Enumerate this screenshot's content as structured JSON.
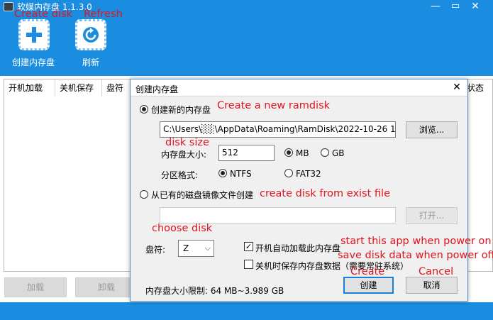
{
  "app": {
    "title": "软媒内存盘 1.1.3.0",
    "window_controls": {
      "minimize": "—",
      "restore": "▭",
      "close": "✕"
    },
    "toolbar": {
      "create_label": "创建内存盘",
      "refresh_label": "刷新"
    },
    "table": {
      "columns": [
        "开机加载",
        "关机保存",
        "盘符",
        "状态"
      ]
    },
    "buttons": {
      "load": "加载",
      "unload": "卸载"
    }
  },
  "dialog": {
    "title": "创建内存盘",
    "close": "✕",
    "option_new": "创建新的内存盘",
    "path_value": "C:\\Users\\░░\\AppData\\Roaming\\RamDisk\\2022-10-26 1",
    "browse_label": "浏览...",
    "size_label": "内存盘大小:",
    "size_value": "512",
    "unit_mb": "MB",
    "unit_gb": "GB",
    "partition_label": "分区格式:",
    "fs_ntfs": "NTFS",
    "fs_fat32": "FAT32",
    "option_image": "从已有的磁盘镜像文件创建",
    "image_path_value": "",
    "open_label": "打开...",
    "drive_label": "盘符:",
    "drive_value": "Z",
    "startup_load_label": "开机自动加载此内存盘",
    "shutdown_save_label": "关机时保存内存盘数据（需要常驻系统）",
    "limit_text": "内存盘大小限制: 64 MB~3.989 GB",
    "create_label": "创建",
    "cancel_label": "取消",
    "state": {
      "option_new_selected": true,
      "unit_mb_selected": true,
      "fs_ntfs_selected": true,
      "startup_load_checked": true,
      "shutdown_save_checked": false
    }
  },
  "annotations": {
    "create_disk": "Create disk",
    "refresh": "Refresh",
    "create_new_ramdisk": "Create a new ramdisk",
    "disk_size": "disk size",
    "create_from_existing": "create disk from exist file",
    "choose_disk": "choose disk",
    "start_on_power": "start this app when power on",
    "save_on_power_off": "save disk data when power off",
    "create": "Create",
    "cancel": "Cancel"
  },
  "colors": {
    "brand_blue": "#1a8de0",
    "annotation_red": "#e0141e",
    "focus_blue": "#1a7fd6"
  }
}
